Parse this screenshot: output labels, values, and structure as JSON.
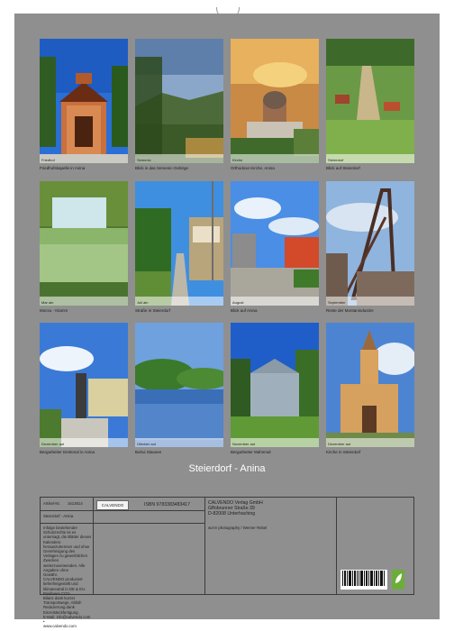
{
  "calendar_title": "Steierdorf - Anina",
  "photos": [
    {
      "caption": "Friedhofskapelle in Anina",
      "tag": "Friedhof"
    },
    {
      "caption": "Blick in das Semenic-Gebirge",
      "tag": "Semenic"
    },
    {
      "caption": "Orthodoxe Kirche, Anina",
      "tag": "Kirche"
    },
    {
      "caption": "Blick auf Steierdorf",
      "tag": "Steierdorf"
    },
    {
      "caption": "Mocsu - Klamm",
      "tag": "Mar ain"
    },
    {
      "caption": "Straße in Steierdorf",
      "tag": "Juli ain"
    },
    {
      "caption": "Blick auf Anina",
      "tag": "August"
    },
    {
      "caption": "Reste der Montanindustrie",
      "tag": "September"
    },
    {
      "caption": "Bergarbeiter Denkmal in Anina",
      "tag": "Dezember aut"
    },
    {
      "caption": "Buhui Stausee",
      "tag": "Oktober aut"
    },
    {
      "caption": "Bergarbeiter Mahnmal",
      "tag": "November aut"
    },
    {
      "caption": "Kirche in Steierdorf",
      "tag": "Dezember aut"
    }
  ],
  "info": {
    "article_label": "Artikel-Nr.",
    "article_number": "1613814",
    "logo_text": "CALVENDO",
    "isbn": "ISBN 9783383483417",
    "publisher_lines": [
      "CALVENDO Verlag GmbH",
      "Gffobrunner Straße 39",
      "D-82008 Unterhaching"
    ],
    "calendar_name": "Steierdorf - Anina",
    "photographer": "wo're photography / Werner Rebel",
    "legal_lines": [
      "Infolge bestehender Schutzrechte ist es",
      "untersagt, die Blätter dieses Kalenders",
      "herauszutrennen und ohne Genehmigung des",
      "Verlages zu gewerblichen Zwecken",
      "weiterzuverwenden. Alle Angaben ohne",
      "Gewähr.",
      "CALVENDO produziert tiefenfreigestellt und",
      "klimaneutral in DE & EU. Positivere CO2-",
      "Bilanz dank kurzer Transportwege, Abfall-",
      "Reduzierung dank Einzelstückfertigung.",
      "E-Mail: info@calvendo.com •",
      "www.calvendo.com"
    ]
  },
  "colors": {
    "sheet_gray": "#8f8f8f",
    "eco_green": "#6cad3a"
  }
}
